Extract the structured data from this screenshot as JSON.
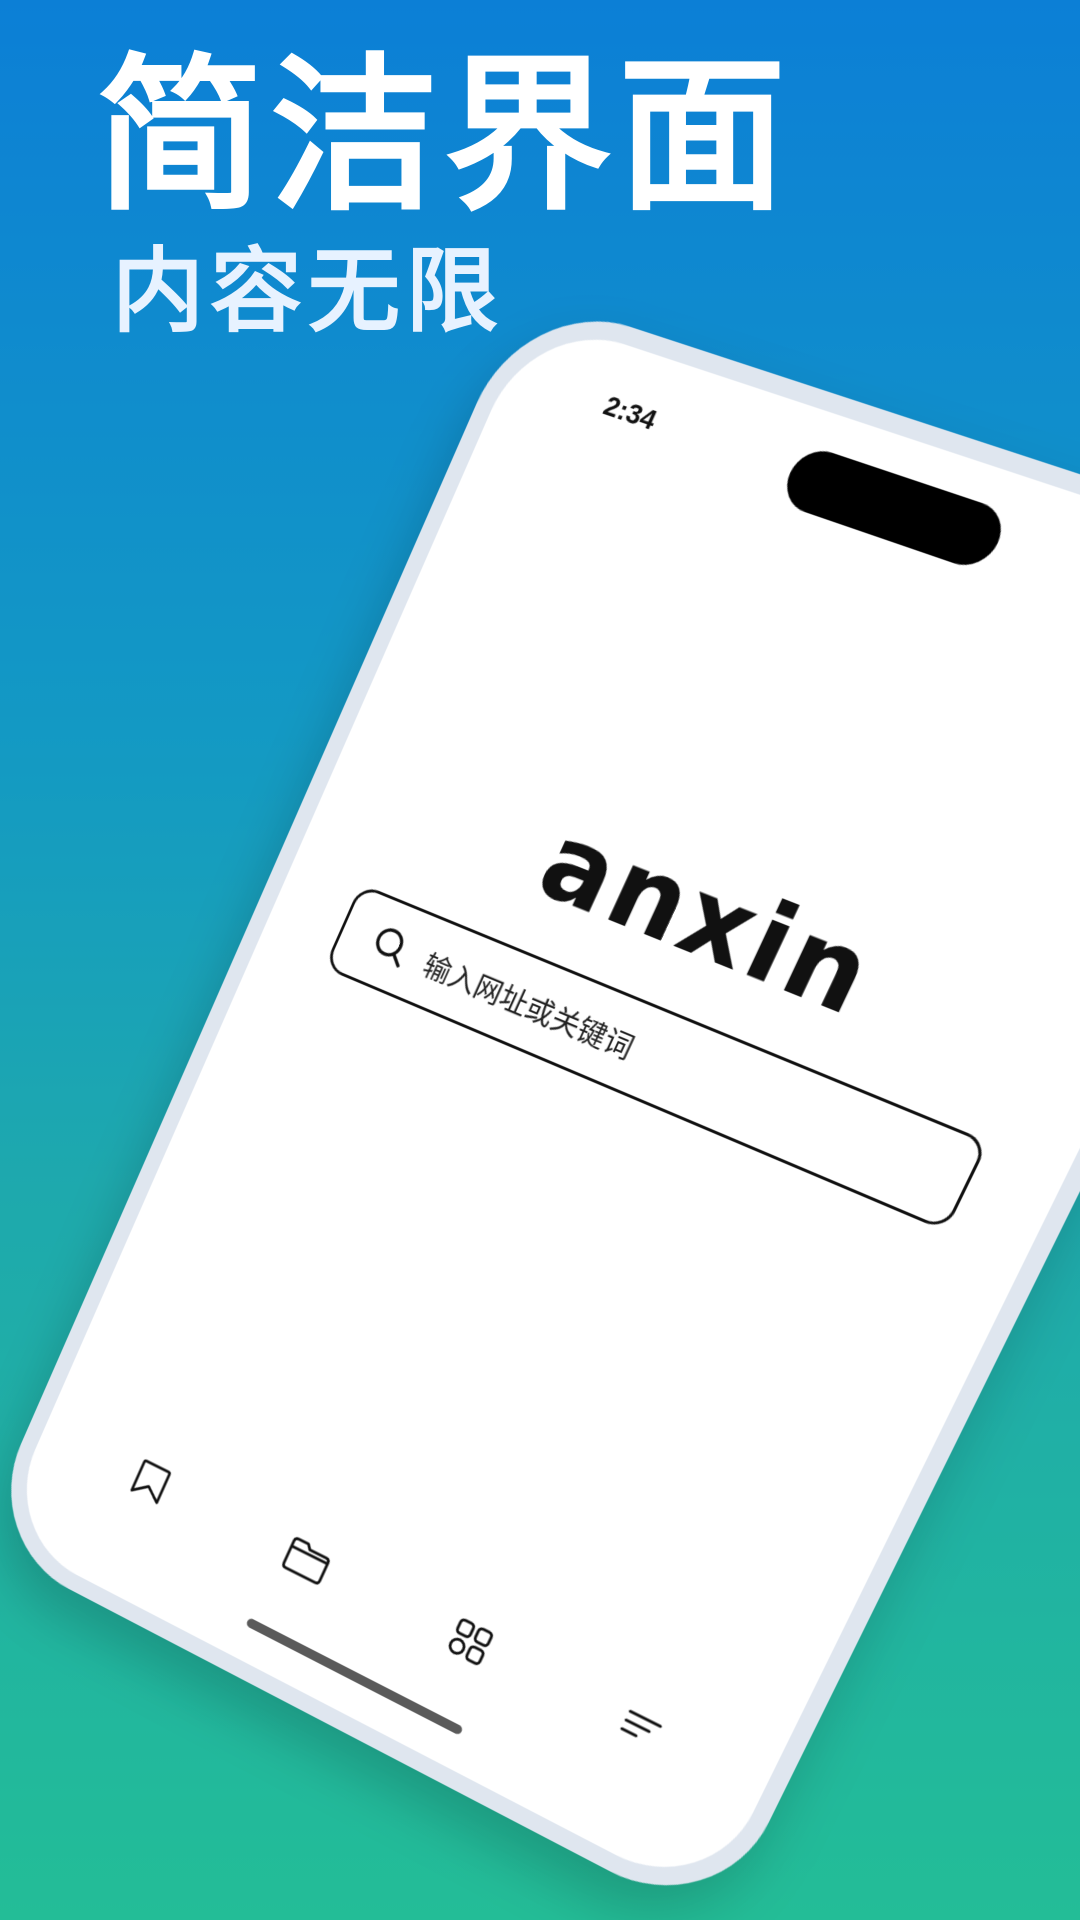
{
  "promo": {
    "headline": "简洁界面",
    "subheadline": "内容无限"
  },
  "status_bar": {
    "time": "2:34",
    "icons": [
      "signal-icon",
      "wifi-icon",
      "battery-icon"
    ]
  },
  "app": {
    "logo_text": "anxin",
    "search": {
      "placeholder": "输入网址或关键词",
      "icon": "search-icon"
    },
    "tabbar": {
      "items": [
        {
          "icon": "bookmark-icon"
        },
        {
          "icon": "folder-icon"
        },
        {
          "icon": "apps-grid-icon"
        },
        {
          "icon": "menu-icon"
        }
      ]
    }
  },
  "colors": {
    "background_top": "#0c7fd6",
    "background_bottom": "#23bd97",
    "phone_screen": "#ffffff"
  }
}
